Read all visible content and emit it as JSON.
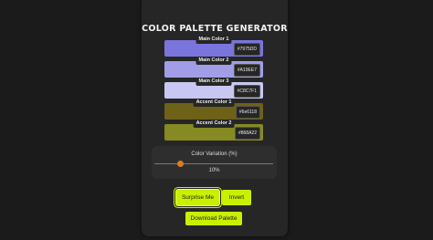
{
  "app": {
    "title": "COLOR PALETTE GENERATOR"
  },
  "palette": [
    {
      "label": "Main Color 1",
      "hex": "#7975DD",
      "color": "#7975DD"
    },
    {
      "label": "Main Color 2",
      "hex": "#A19EE7",
      "color": "#A19EE7"
    },
    {
      "label": "Main Color 3",
      "hex": "#C8C7F1",
      "color": "#C8C7F1"
    },
    {
      "label": "Accent Color 1",
      "hex": "#6e6118",
      "color": "#6E6118"
    },
    {
      "label": "Accent Color 2",
      "hex": "#868A22",
      "color": "#868A22"
    }
  ],
  "variation": {
    "label": "Color Variation (%)",
    "value_text": "10%",
    "value": 10,
    "accent": "#E07B20"
  },
  "buttons": {
    "surprise": "Surprise Me",
    "invert": "Invert",
    "download": "Download Palette",
    "color": "#C8F000"
  }
}
